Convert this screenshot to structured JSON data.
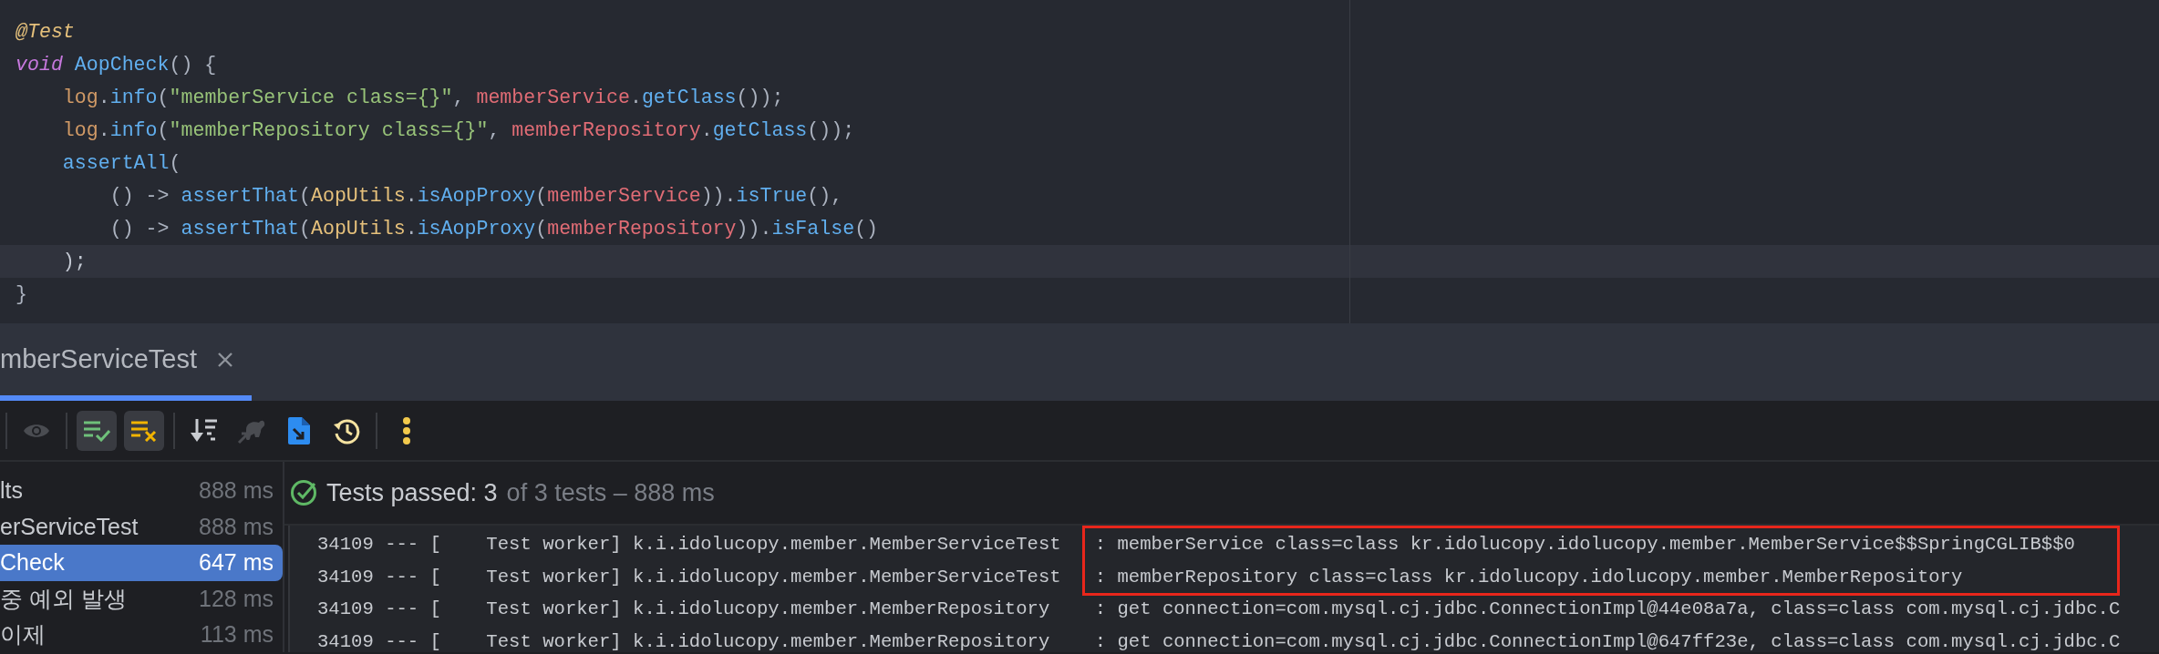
{
  "editor": {
    "lines": [
      {
        "current": false,
        "tokens": [
          {
            "text": "@Test",
            "kind": "annotation"
          }
        ]
      },
      {
        "current": false,
        "tokens": [
          {
            "text": "void",
            "kind": "keyword"
          },
          {
            "text": " AopCheck",
            "kind": "method"
          },
          {
            "text": "() {",
            "kind": "punct"
          }
        ]
      },
      {
        "current": false,
        "tokens": [
          {
            "text": "    log",
            "kind": "static_field"
          },
          {
            "text": ".",
            "kind": "punct"
          },
          {
            "text": "info",
            "kind": "method"
          },
          {
            "text": "(",
            "kind": "punct"
          },
          {
            "text": "\"memberService class={}\"",
            "kind": "string"
          },
          {
            "text": ", ",
            "kind": "punct"
          },
          {
            "text": "memberService",
            "kind": "field"
          },
          {
            "text": ".",
            "kind": "punct"
          },
          {
            "text": "getClass",
            "kind": "method"
          },
          {
            "text": "());",
            "kind": "punct"
          }
        ]
      },
      {
        "current": false,
        "tokens": [
          {
            "text": "    log",
            "kind": "static_field"
          },
          {
            "text": ".",
            "kind": "punct"
          },
          {
            "text": "info",
            "kind": "method"
          },
          {
            "text": "(",
            "kind": "punct"
          },
          {
            "text": "\"memberRepository class={}\"",
            "kind": "string"
          },
          {
            "text": ", ",
            "kind": "punct"
          },
          {
            "text": "memberRepository",
            "kind": "field"
          },
          {
            "text": ".",
            "kind": "punct"
          },
          {
            "text": "getClass",
            "kind": "method"
          },
          {
            "text": "());",
            "kind": "punct"
          }
        ]
      },
      {
        "current": false,
        "tokens": [
          {
            "text": "    assertAll",
            "kind": "method"
          },
          {
            "text": "(",
            "kind": "punct"
          }
        ]
      },
      {
        "current": false,
        "tokens": [
          {
            "text": "        () -> ",
            "kind": "punct"
          },
          {
            "text": "assertThat",
            "kind": "method"
          },
          {
            "text": "(",
            "kind": "punct"
          },
          {
            "text": "AopUtils",
            "kind": "class"
          },
          {
            "text": ".",
            "kind": "punct"
          },
          {
            "text": "isAopProxy",
            "kind": "method"
          },
          {
            "text": "(",
            "kind": "punct"
          },
          {
            "text": "memberService",
            "kind": "field"
          },
          {
            "text": ")).",
            "kind": "punct"
          },
          {
            "text": "isTrue",
            "kind": "method"
          },
          {
            "text": "(),",
            "kind": "punct"
          }
        ]
      },
      {
        "current": false,
        "tokens": [
          {
            "text": "        () -> ",
            "kind": "punct"
          },
          {
            "text": "assertThat",
            "kind": "method"
          },
          {
            "text": "(",
            "kind": "punct"
          },
          {
            "text": "AopUtils",
            "kind": "class"
          },
          {
            "text": ".",
            "kind": "punct"
          },
          {
            "text": "isAopProxy",
            "kind": "method"
          },
          {
            "text": "(",
            "kind": "punct"
          },
          {
            "text": "memberRepository",
            "kind": "field"
          },
          {
            "text": ")).",
            "kind": "punct"
          },
          {
            "text": "isFalse",
            "kind": "method"
          },
          {
            "text": "()",
            "kind": "punct"
          }
        ]
      },
      {
        "current": true,
        "tokens": [
          {
            "text": "    );",
            "kind": "punct"
          }
        ]
      },
      {
        "current": false,
        "tokens": [
          {
            "text": "}",
            "kind": "punct"
          }
        ]
      }
    ]
  },
  "tabs": [
    {
      "label": "mberServiceTest",
      "selected": true
    }
  ],
  "toolbar": {
    "groups": [
      [
        {
          "kind": "eye",
          "on": false,
          "disabled": true
        }
      ],
      [
        {
          "kind": "show_passed",
          "on": true,
          "disabled": false
        },
        {
          "kind": "show_ignored",
          "on": true,
          "disabled": false
        }
      ],
      [
        {
          "kind": "sort",
          "on": false,
          "disabled": false
        },
        {
          "kind": "gradle",
          "on": false,
          "disabled": true
        },
        {
          "kind": "import",
          "on": false,
          "disabled": false
        },
        {
          "kind": "history",
          "on": false,
          "disabled": false
        }
      ],
      [
        {
          "kind": "more",
          "on": false,
          "disabled": false
        }
      ]
    ]
  },
  "tree": [
    {
      "label": "lts",
      "time": "888 ms",
      "selected": false,
      "children": [
        {
          "label": "erServiceTest",
          "time": "888 ms",
          "selected": false,
          "children": [
            {
              "label": "Check",
              "time": "647 ms",
              "selected": true
            },
            {
              "label": "중 예외 발생",
              "time": "128 ms",
              "selected": false
            },
            {
              "label": "이제",
              "time": "113 ms",
              "selected": false
            }
          ]
        }
      ]
    }
  ],
  "results_header": {
    "passed": "Tests passed: 3",
    "detail": "of 3 tests – 888 ms"
  },
  "log": [
    {
      "source": "34109 --- [    Test worker] k.i.idolucopy.member.MemberServiceTest   ",
      "message": ": memberService class=class kr.idolucopy.idolucopy.member.MemberService$$SpringCGLIB$$0",
      "highlighted": true
    },
    {
      "source": "34109 --- [    Test worker] k.i.idolucopy.member.MemberServiceTest   ",
      "message": ": memberRepository class=class kr.idolucopy.idolucopy.member.MemberRepository",
      "highlighted": true
    },
    {
      "source": "34109 --- [    Test worker] k.i.idolucopy.member.MemberRepository    ",
      "message": ": get connection=com.mysql.cj.jdbc.ConnectionImpl@44e08a7a, class=class com.mysql.cj.jdbc.C",
      "highlighted": false
    },
    {
      "source": "34109 --- [    Test worker] k.i.idolucopy.member.MemberRepository    ",
      "message": ": get connection=com.mysql.cj.jdbc.ConnectionImpl@647ff23e, class=class com.mysql.cj.jdbc.C",
      "highlighted": false
    }
  ]
}
